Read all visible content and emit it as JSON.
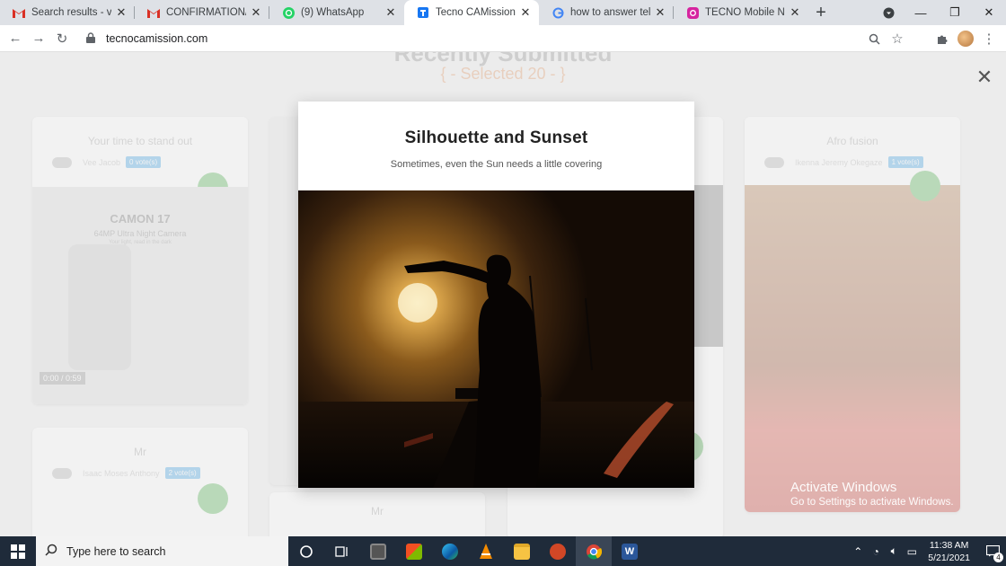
{
  "browser": {
    "tabs": [
      {
        "title": "Search results - vee.ac",
        "favicon": "gmail-icon"
      },
      {
        "title": "CONFIRMATION/PRO",
        "favicon": "gmail-icon"
      },
      {
        "title": "(9) WhatsApp",
        "favicon": "whatsapp-icon"
      },
      {
        "title": "Tecno CAMission Com",
        "favicon": "tecno-icon",
        "active": true
      },
      {
        "title": "how to answer tell us a",
        "favicon": "google-icon"
      },
      {
        "title": "TECNO Mobile Nigeria",
        "favicon": "instagram-icon"
      }
    ],
    "url": "tecnocamission.com"
  },
  "page": {
    "bg_heading_partial": "Recently Submitted",
    "bg_subheading": "{ - Selected 20 - }",
    "cards": [
      {
        "title": "Your time to stand out",
        "name": "Vee Jacob",
        "votes": "0 vote(s)",
        "promo_title": "CAMON 17 ",
        "promo_sub": "64MP Ultra Night Camera",
        "promo_tag": "Your light, read in the dark",
        "video_time": "0:00 / 0:59"
      },
      {
        "title": "Afro fusion",
        "name": "Ikenna Jeremy Okegaze",
        "votes": "1 vote(s)"
      },
      {
        "title": "Mr",
        "name": "Isaac Moses Anthony",
        "votes": "2 vote(s)"
      },
      {
        "title": "Mr",
        "name": "",
        "votes": ""
      }
    ]
  },
  "modal": {
    "title": "Silhouette and Sunset",
    "caption": "Sometimes, even the Sun needs a little covering"
  },
  "watermark": {
    "line1": "Activate Windows",
    "line2": "Go to Settings to activate Windows."
  },
  "taskbar": {
    "search_placeholder": "Type here to search",
    "time": "11:38 AM",
    "date": "5/21/2021",
    "notifications": "4"
  },
  "colors": {
    "tab_strip": "#dee1e6",
    "taskbar": "#1f2b3a",
    "vote_badge": "#4aa9e9",
    "share_button": "#5cb85c"
  }
}
